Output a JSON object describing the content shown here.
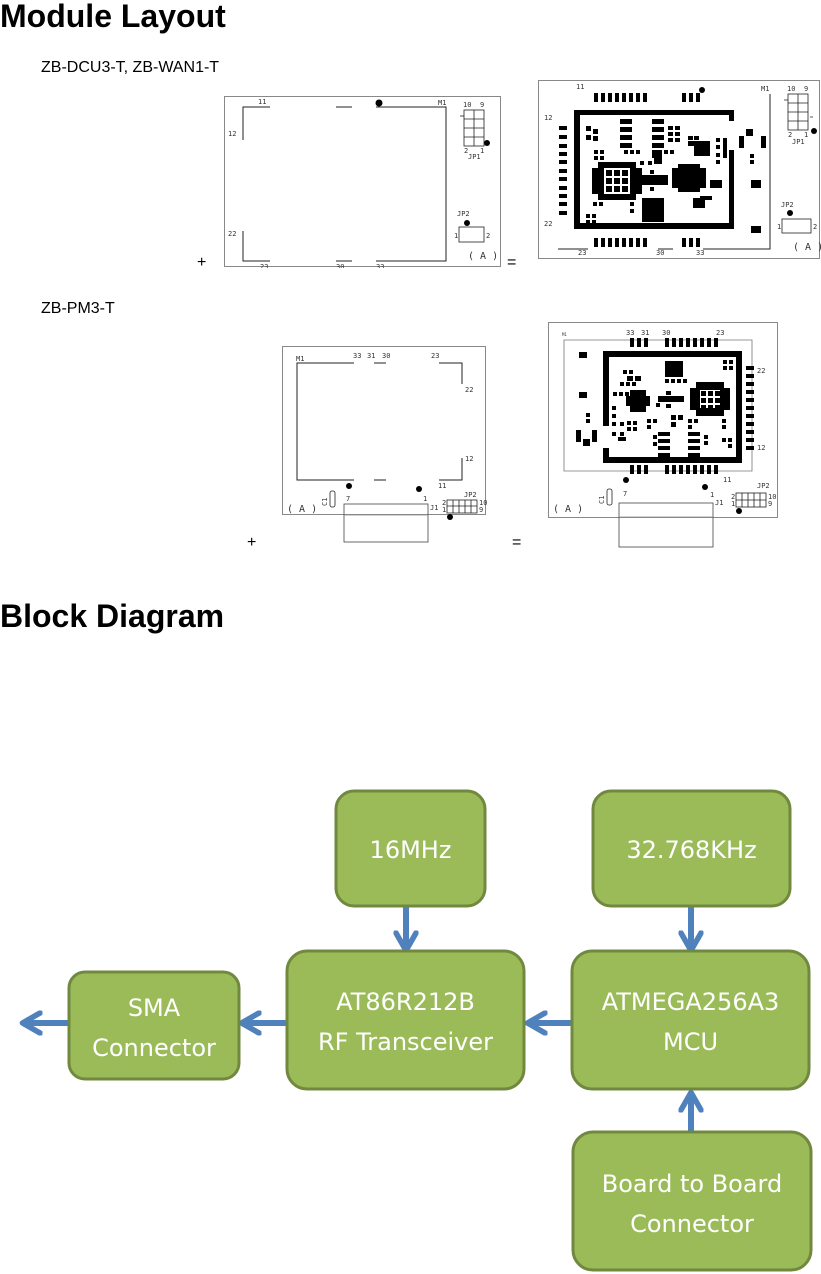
{
  "sections": {
    "module_layout": {
      "title": "Module Layout",
      "groups": [
        {
          "label": "ZB-DCU3-T, ZB-WAN1-T",
          "plus": "+",
          "equals": "=",
          "pcb_labels": {
            "module": "M1",
            "jp1": "JP1",
            "jp2": "JP2",
            "variant": "( A )",
            "pins": [
              "11",
              "12",
              "22",
              "23",
              "30",
              "33"
            ],
            "jp1_pins": [
              "10",
              "9",
              "2",
              "1"
            ],
            "jp2_pins": [
              "1",
              "2"
            ]
          }
        },
        {
          "label": "ZB-PM3-T",
          "plus": "+",
          "equals": "=",
          "pcb_labels": {
            "module": "M1",
            "connector": "J1",
            "capacitor": "C1",
            "jp2": "JP2",
            "variant": "( A )",
            "pins": [
              "33",
              "31",
              "30",
              "23",
              "22",
              "12",
              "11"
            ],
            "j1_pins": [
              "7",
              "1"
            ],
            "jp2_pins": [
              "2",
              "1",
              "10",
              "9"
            ]
          }
        }
      ]
    },
    "block_diagram": {
      "title": "Block Diagram",
      "colors": {
        "block_fill": "#9BBB59",
        "block_border": "#71893F",
        "block_text": "#FFFFFF",
        "arrow": "#4F81BD"
      },
      "blocks": {
        "osc16": [
          "16MHz"
        ],
        "osc32": [
          "32.768KHz"
        ],
        "sma": [
          "SMA",
          "Connector"
        ],
        "rf": [
          "AT86R212B",
          "RF Transceiver"
        ],
        "mcu": [
          "ATMEGA256A3",
          "MCU"
        ],
        "b2b": [
          "Board to Board",
          "Connector"
        ]
      },
      "connections": [
        {
          "from": "osc16",
          "to": "rf"
        },
        {
          "from": "osc32",
          "to": "mcu"
        },
        {
          "from": "mcu",
          "to": "rf"
        },
        {
          "from": "rf",
          "to": "sma"
        },
        {
          "from": "sma",
          "to": "antenna-out"
        },
        {
          "from": "b2b",
          "to": "mcu"
        }
      ]
    }
  }
}
